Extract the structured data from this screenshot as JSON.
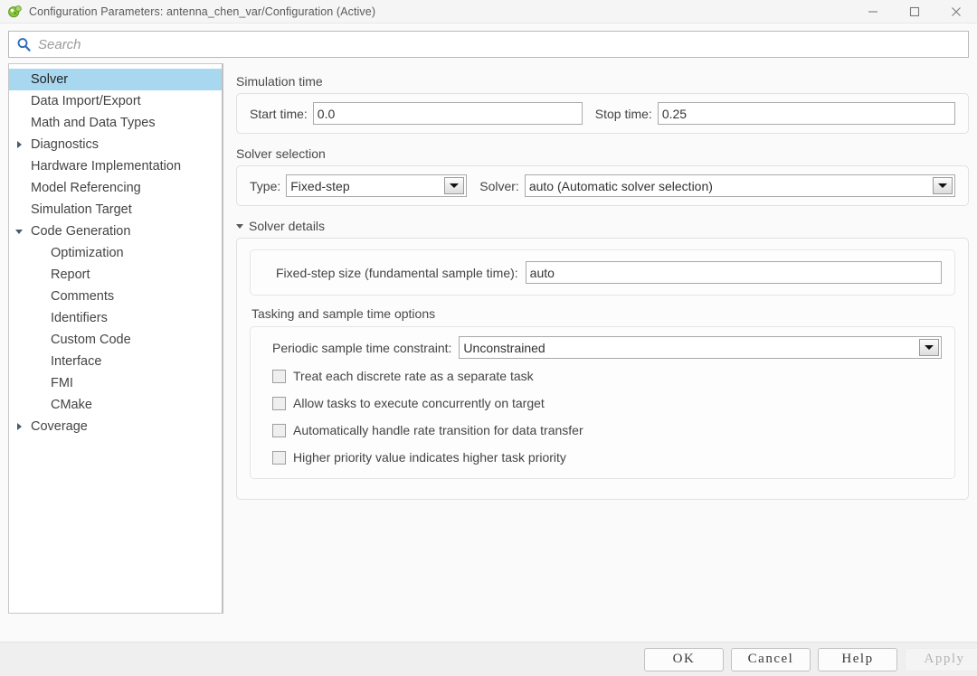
{
  "titlebar": {
    "icon": "simulink-logo-icon",
    "title": "Configuration Parameters: antenna_chen_var/Configuration (Active)",
    "minimize": "minimize-icon",
    "maximize": "maximize-icon",
    "close": "close-icon"
  },
  "search": {
    "icon": "search-icon",
    "placeholder": "Search",
    "value": ""
  },
  "sidebar": {
    "items": [
      {
        "label": "Solver",
        "indent": 0,
        "arrow": "none",
        "selected": true
      },
      {
        "label": "Data Import/Export",
        "indent": 0,
        "arrow": "none",
        "selected": false
      },
      {
        "label": "Math and Data Types",
        "indent": 0,
        "arrow": "none",
        "selected": false
      },
      {
        "label": "Diagnostics",
        "indent": 0,
        "arrow": "collapsed",
        "selected": false
      },
      {
        "label": "Hardware Implementation",
        "indent": 0,
        "arrow": "none",
        "selected": false
      },
      {
        "label": "Model Referencing",
        "indent": 0,
        "arrow": "none",
        "selected": false
      },
      {
        "label": "Simulation Target",
        "indent": 0,
        "arrow": "none",
        "selected": false
      },
      {
        "label": "Code Generation",
        "indent": 0,
        "arrow": "expanded",
        "selected": false
      },
      {
        "label": "Optimization",
        "indent": 1,
        "arrow": "none",
        "selected": false
      },
      {
        "label": "Report",
        "indent": 1,
        "arrow": "none",
        "selected": false
      },
      {
        "label": "Comments",
        "indent": 1,
        "arrow": "none",
        "selected": false
      },
      {
        "label": "Identifiers",
        "indent": 1,
        "arrow": "none",
        "selected": false
      },
      {
        "label": "Custom Code",
        "indent": 1,
        "arrow": "none",
        "selected": false
      },
      {
        "label": "Interface",
        "indent": 1,
        "arrow": "none",
        "selected": false
      },
      {
        "label": "FMI",
        "indent": 1,
        "arrow": "none",
        "selected": false
      },
      {
        "label": "CMake",
        "indent": 1,
        "arrow": "none",
        "selected": false
      },
      {
        "label": "Coverage",
        "indent": 0,
        "arrow": "collapsed",
        "selected": false
      }
    ]
  },
  "main": {
    "simulation_time": {
      "title": "Simulation time",
      "start_label": "Start time:",
      "start_value": "0.0",
      "stop_label": "Stop time:",
      "stop_value": "0.25"
    },
    "solver_selection": {
      "title": "Solver selection",
      "type_label": "Type:",
      "type_value": "Fixed-step",
      "solver_label": "Solver:",
      "solver_value": "auto (Automatic solver selection)"
    },
    "solver_details": {
      "title": "Solver details",
      "fixed_step_label": "Fixed-step size (fundamental sample time):",
      "fixed_step_value": "auto",
      "tasking_title": "Tasking and sample time options",
      "periodic_label": "Periodic sample time constraint:",
      "periodic_value": "Unconstrained",
      "checkboxes": [
        {
          "label": "Treat each discrete rate as a separate task",
          "checked": false
        },
        {
          "label": "Allow tasks to execute concurrently on target",
          "checked": false
        },
        {
          "label": "Automatically handle rate transition for data transfer",
          "checked": false
        },
        {
          "label": "Higher priority value indicates higher task priority",
          "checked": false
        }
      ]
    }
  },
  "footer": {
    "ok": "OK",
    "cancel": "Cancel",
    "help": "Help",
    "apply": "Apply",
    "apply_enabled": false
  },
  "colors": {
    "selection": "#a8d8f0",
    "search_icon": "#2f6fb5",
    "logo_green": "#7ac043",
    "text": "#444444"
  }
}
